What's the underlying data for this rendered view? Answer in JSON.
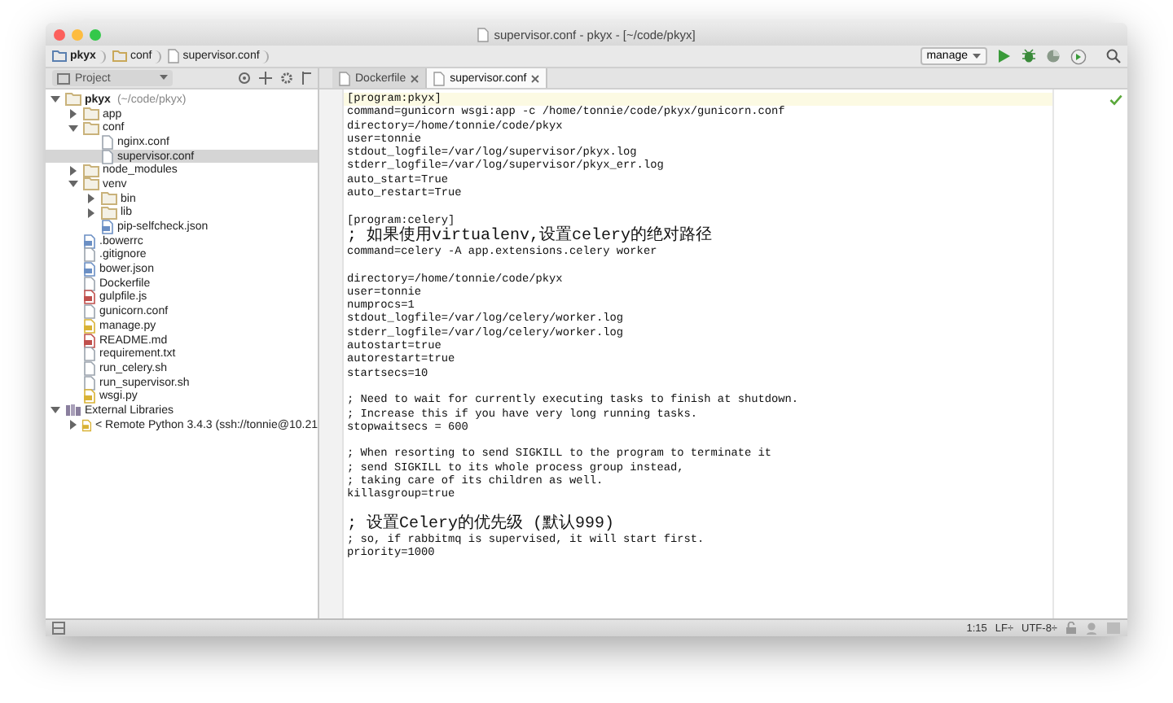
{
  "window": {
    "title": "supervisor.conf - pkyx - [~/code/pkyx]"
  },
  "navbar": {
    "breadcrumbs": [
      {
        "label": "pkyx",
        "kind": "folder"
      },
      {
        "label": "conf",
        "kind": "folder"
      },
      {
        "label": "supervisor.conf",
        "kind": "file"
      }
    ],
    "run_config": "manage"
  },
  "project_panel": {
    "title": "Project",
    "tree": [
      {
        "label": "pkyx",
        "hint": "(~/code/pkyx)",
        "kind": "folder",
        "expanded": true,
        "selected": false,
        "bold": true,
        "children": [
          {
            "label": "app",
            "kind": "folder",
            "expanded": false,
            "selected": false
          },
          {
            "label": "conf",
            "kind": "folder",
            "expanded": true,
            "selected": false,
            "children": [
              {
                "label": "nginx.conf",
                "kind": "file",
                "selected": false
              },
              {
                "label": "supervisor.conf",
                "kind": "file",
                "selected": true
              }
            ]
          },
          {
            "label": "node_modules",
            "kind": "folder",
            "expanded": false,
            "selected": false
          },
          {
            "label": "venv",
            "kind": "folder",
            "expanded": true,
            "selected": false,
            "children": [
              {
                "label": "bin",
                "kind": "folder",
                "expanded": false,
                "selected": false
              },
              {
                "label": "lib",
                "kind": "folder",
                "expanded": false,
                "selected": false
              },
              {
                "label": "pip-selfcheck.json",
                "kind": "json",
                "selected": false
              }
            ]
          },
          {
            "label": ".bowerrc",
            "kind": "json",
            "selected": false
          },
          {
            "label": ".gitignore",
            "kind": "file",
            "selected": false
          },
          {
            "label": "bower.json",
            "kind": "json",
            "selected": false
          },
          {
            "label": "Dockerfile",
            "kind": "file",
            "selected": false
          },
          {
            "label": "gulpfile.js",
            "kind": "script",
            "selected": false
          },
          {
            "label": "gunicorn.conf",
            "kind": "file",
            "selected": false
          },
          {
            "label": "manage.py",
            "kind": "python",
            "selected": false
          },
          {
            "label": "README.md",
            "kind": "script",
            "selected": false
          },
          {
            "label": "requirement.txt",
            "kind": "file",
            "selected": false
          },
          {
            "label": "run_celery.sh",
            "kind": "file",
            "selected": false
          },
          {
            "label": "run_supervisor.sh",
            "kind": "file",
            "selected": false
          },
          {
            "label": "wsgi.py",
            "kind": "python",
            "selected": false
          }
        ]
      },
      {
        "label": "External Libraries",
        "kind": "library",
        "expanded": true,
        "selected": false,
        "children": [
          {
            "label": "< Remote Python 3.4.3 (ssh://tonnie@10.21",
            "kind": "python",
            "expanded": false,
            "selected": false
          }
        ]
      }
    ]
  },
  "tabs": [
    {
      "label": "Dockerfile",
      "selected": false
    },
    {
      "label": "supervisor.conf",
      "selected": true
    }
  ],
  "editor": {
    "lines": [
      {
        "text": "[program:pkyx]",
        "current": true
      },
      {
        "text": "command=gunicorn wsgi:app -c /home/tonnie/code/pkyx/gunicorn.conf",
        "current": false
      },
      {
        "text": "directory=/home/tonnie/code/pkyx",
        "current": false
      },
      {
        "text": "user=tonnie",
        "current": false
      },
      {
        "text": "stdout_logfile=/var/log/supervisor/pkyx.log",
        "current": false
      },
      {
        "text": "stderr_logfile=/var/log/supervisor/pkyx_err.log",
        "current": false
      },
      {
        "text": "auto_start=True",
        "current": false
      },
      {
        "text": "auto_restart=True",
        "current": false
      },
      {
        "current": false
      },
      {
        "text": "[program:celery]",
        "current": false
      },
      {
        "text": "; 如果使用virtualenv,设置celery的绝对路径",
        "current": false
      },
      {
        "text": "command=celery -A app.extensions.celery worker",
        "current": false
      },
      {
        "current": false
      },
      {
        "text": "directory=/home/tonnie/code/pkyx",
        "current": false
      },
      {
        "text": "user=tonnie",
        "current": false
      },
      {
        "text": "numprocs=1",
        "current": false
      },
      {
        "text": "stdout_logfile=/var/log/celery/worker.log",
        "current": false
      },
      {
        "text": "stderr_logfile=/var/log/celery/worker.log",
        "current": false
      },
      {
        "text": "autostart=true",
        "current": false
      },
      {
        "text": "autorestart=true",
        "current": false
      },
      {
        "text": "startsecs=10",
        "current": false
      },
      {
        "current": false
      },
      {
        "text": "; Need to wait for currently executing tasks to finish at shutdown.",
        "current": false
      },
      {
        "text": "; Increase this if you have very long running tasks.",
        "current": false
      },
      {
        "text": "stopwaitsecs = 600",
        "current": false
      },
      {
        "current": false
      },
      {
        "text": "; When resorting to send SIGKILL to the program to terminate it",
        "current": false
      },
      {
        "text": "; send SIGKILL to its whole process group instead,",
        "current": false
      },
      {
        "text": "; taking care of its children as well.",
        "current": false
      },
      {
        "text": "killasgroup=true",
        "current": false
      },
      {
        "current": false
      },
      {
        "text": "; 设置Celery的优先级 (默认999)",
        "current": false
      },
      {
        "text": "; so, if rabbitmq is supervised, it will start first.",
        "current": false
      },
      {
        "text": "priority=1000",
        "current": false
      }
    ]
  },
  "status_bar": {
    "position": "1:15",
    "line_separator": "LF÷",
    "encoding": "UTF-8÷"
  }
}
